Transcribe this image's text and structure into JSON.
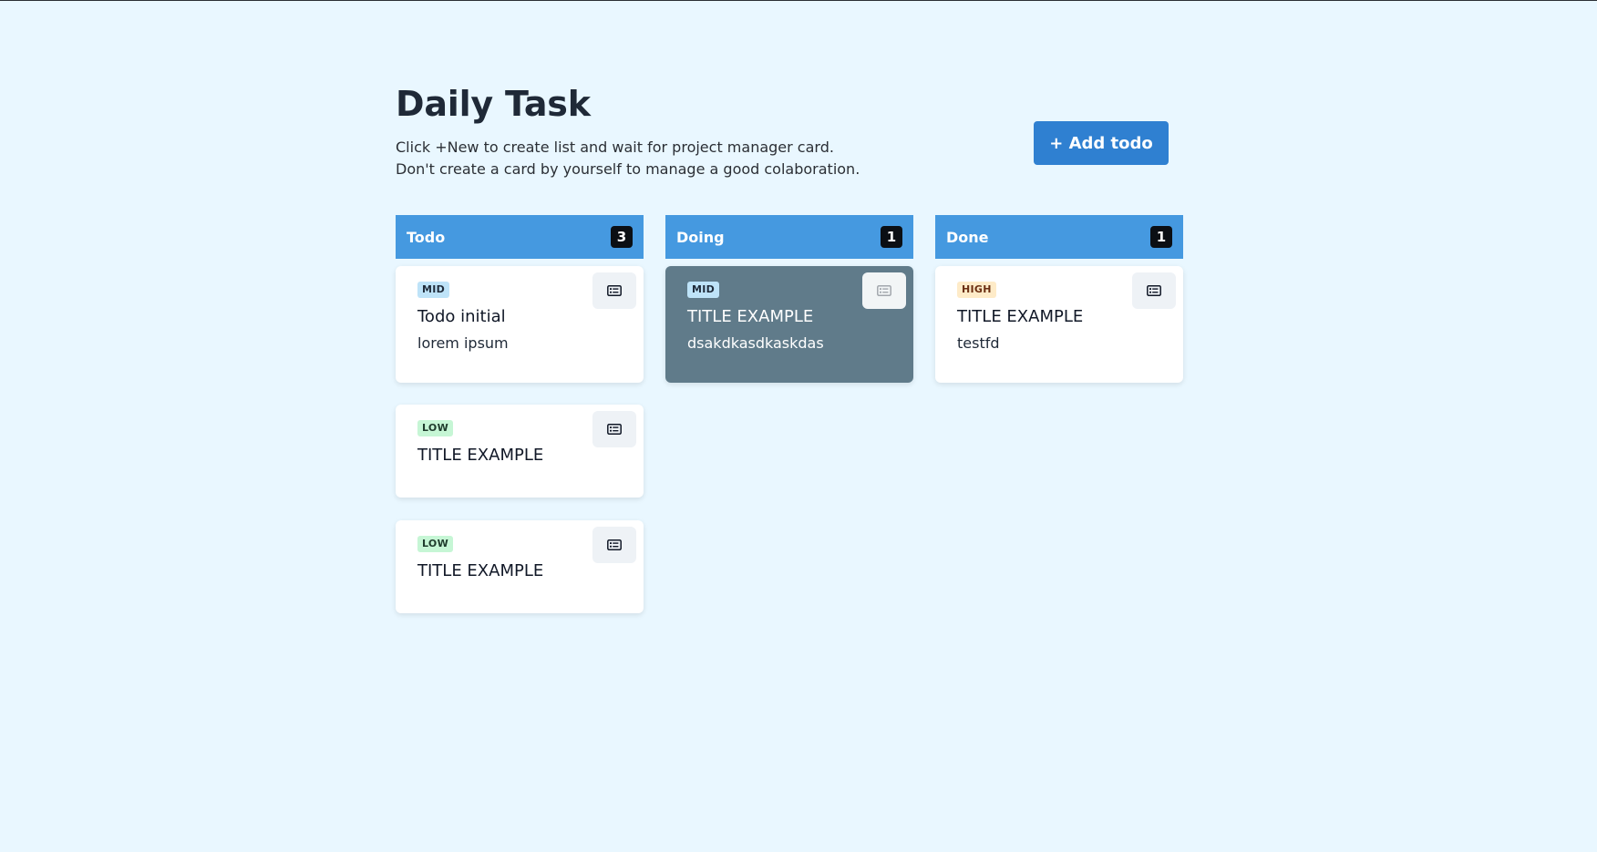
{
  "page": {
    "title": "Daily Task",
    "subtitle_line1": "Click +New to create list and wait for project manager card.",
    "subtitle_line2": "Don't create a card by yourself to manage a good colaboration."
  },
  "actions": {
    "add_todo_label": "+ Add todo"
  },
  "board": {
    "columns": [
      {
        "name": "Todo",
        "count": "3",
        "cards": [
          {
            "priority": "MID",
            "title": "Todo initial",
            "description": "lorem ipsum",
            "icon": "list-icon"
          },
          {
            "priority": "LOW",
            "title": "TITLE EXAMPLE",
            "description": "",
            "icon": "list-icon"
          },
          {
            "priority": "LOW",
            "title": "TITLE EXAMPLE",
            "description": "",
            "icon": "list-icon"
          }
        ]
      },
      {
        "name": "Doing",
        "count": "1",
        "cards": [
          {
            "priority": "MID",
            "title": "TITLE EXAMPLE",
            "description": "dsakdkasdkaskdas",
            "icon": "list-icon"
          }
        ]
      },
      {
        "name": "Done",
        "count": "1",
        "cards": [
          {
            "priority": "HIGH",
            "title": "TITLE EXAMPLE",
            "description": "testfd",
            "icon": "list-icon"
          }
        ]
      }
    ]
  },
  "colors": {
    "background": "#e9f7ff",
    "column_header": "#4599e0",
    "add_button": "#2f80d1",
    "doing_card": "#607b8a",
    "badge_mid": "#bee3f8",
    "badge_low": "#c6f6d5",
    "badge_high": "#feebc8"
  }
}
